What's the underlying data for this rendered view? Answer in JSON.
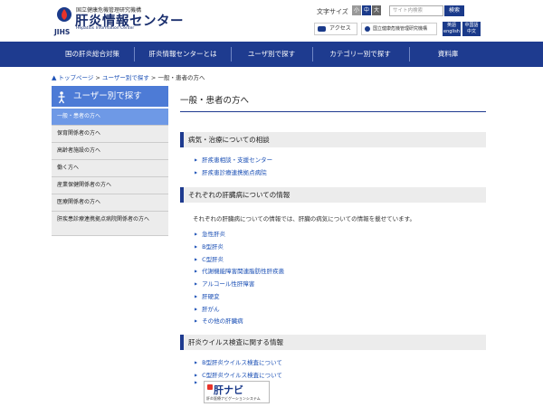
{
  "header": {
    "org_name": "国立健康危機管理研究機構",
    "site_name": "肝炎情報センター",
    "site_name_en": "Hepatitis Information Center",
    "logo_abbr": "JIHS",
    "font_size_label": "文字サイズ",
    "font_sizes": [
      "小",
      "中",
      "大"
    ],
    "search_placeholder": "サイト内検索",
    "search_button": "検索",
    "access_label": "アクセス",
    "org_link": "国立健康危機管理研究機構",
    "lang_en": [
      "英語",
      "english"
    ],
    "lang_zh": [
      "中国語",
      "中文"
    ]
  },
  "nav": [
    "国の肝炎総合対策",
    "肝炎情報センターとは",
    "ユーザ別で探す",
    "カテゴリー別で探す",
    "資料庫"
  ],
  "breadcrumb": {
    "home": "トップページ",
    "parent": "ユーザー別で探す",
    "current": "一般・患者の方へ",
    "sep": ">"
  },
  "sidebar": {
    "title": "ユーザー別で探す",
    "items": [
      "一般・患者の方へ",
      "保育関係者の方へ",
      "高齢者施設の方へ",
      "働く方へ",
      "産業保健関係者の方へ",
      "医療関係者の方へ",
      "肝疾患診療連携拠点病院関係者の方へ"
    ]
  },
  "main": {
    "title": "一般・患者の方へ",
    "sections": [
      {
        "heading": "病気・治療についての相談",
        "links": [
          "肝疾患相談・支援センター",
          "肝疾患診療連携拠点病院"
        ]
      },
      {
        "heading": "それぞれの肝臓病についての情報",
        "description": "それぞれの肝臓病についての情報では、肝臓の病気についての情報を載せています。",
        "links": [
          "急性肝炎",
          "B型肝炎",
          "C型肝炎",
          "代謝機能障害関連脂肪性肝疾患",
          "アルコール性肝障害",
          "肝硬変",
          "肝がん",
          "その他の肝臓病"
        ]
      },
      {
        "heading": "肝炎ウイルス検査に関する情報",
        "links": [
          "B型肝炎ウイルス検査について",
          "C型肝炎ウイルス検査について"
        ]
      }
    ],
    "banner": {
      "title": "肝ナビ",
      "subtitle": "肝炎医療ナビゲーションシステム"
    }
  },
  "colors": {
    "nav": "#1e3b8f",
    "sidebar_head": "#4d7bd6",
    "sidebar_active": "#6e99e6",
    "link": "#1a4fb5",
    "font_small": "#999999",
    "font_mid": "#1a3a8a",
    "font_large": "#666666"
  }
}
